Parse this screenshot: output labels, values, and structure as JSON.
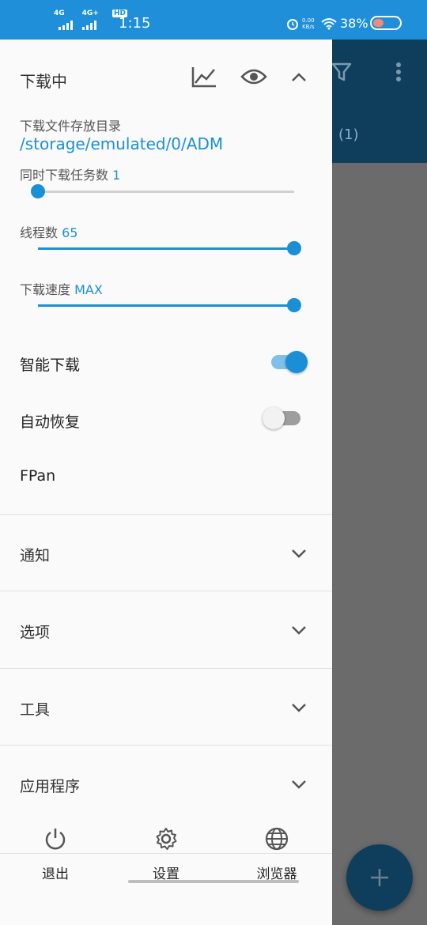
{
  "status_bar": {
    "signal1": "4G",
    "signal2": "4G+",
    "hd": "HD",
    "time": "1:15",
    "net_speed": "0.00",
    "net_unit": "KB/s",
    "battery": "38%"
  },
  "background_app": {
    "count": "(1)"
  },
  "drawer": {
    "title": "下载中",
    "folder_label": "下载文件存放目录",
    "folder_path": "/storage/emulated/0/ADM",
    "concurrent_label": "同时下载任务数",
    "concurrent_value": "1",
    "concurrent_fraction": 0.0,
    "threads_label": "线程数",
    "threads_value": "65",
    "threads_fraction": 1.0,
    "speed_label": "下载速度",
    "speed_value": "MAX",
    "speed_fraction": 1.0,
    "smart_download_label": "智能下载",
    "smart_download_on": true,
    "auto_resume_label": "自动恢复",
    "auto_resume_on": false,
    "fpan_label": "FPan",
    "sections": [
      "通知",
      "选项",
      "工具",
      "应用程序"
    ]
  },
  "bottom_nav": {
    "exit": "退出",
    "settings": "设置",
    "browser": "浏览器"
  },
  "colors": {
    "accent": "#1a8fd6",
    "status_bar": "#1e8fd8",
    "app_bar": "#0f3e5c"
  },
  "icons": [
    "chart-icon",
    "eye-icon",
    "chevron-up-icon",
    "filter-icon",
    "more-vert-icon",
    "plus-icon",
    "power-icon",
    "gear-icon",
    "globe-icon"
  ]
}
